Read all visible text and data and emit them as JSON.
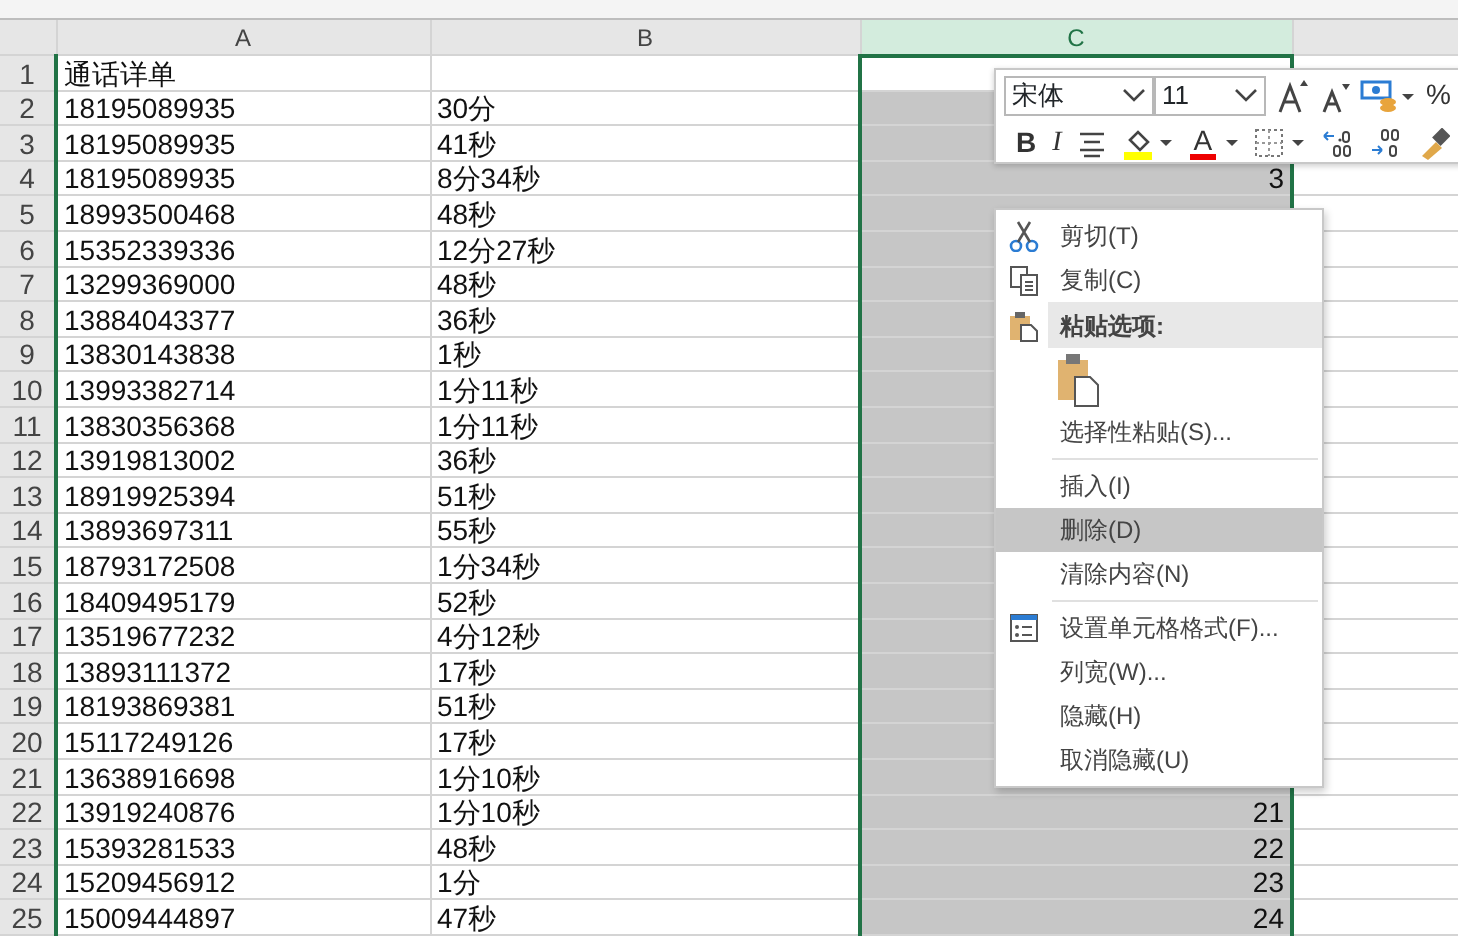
{
  "columns": [
    {
      "label": "A",
      "selected": false
    },
    {
      "label": "B",
      "selected": false
    },
    {
      "label": "C",
      "selected": true
    }
  ],
  "rows": [
    {
      "number": "1",
      "a": "通话详单",
      "b": "",
      "c": {
        "selected": false
      }
    },
    {
      "number": "2",
      "a": "18195089935",
      "b": "30分",
      "c": {
        "selected": true
      }
    },
    {
      "number": "3",
      "a": "18195089935",
      "b": "41秒",
      "c": {
        "selected": true
      }
    },
    {
      "number": "4",
      "a": "18195089935",
      "b": "8分34秒",
      "c": {
        "text": "3",
        "selected": true
      }
    },
    {
      "number": "5",
      "a": "18993500468",
      "b": "48秒",
      "c": {
        "selected": true
      }
    },
    {
      "number": "6",
      "a": "15352339336",
      "b": "12分27秒",
      "c": {
        "selected": true
      }
    },
    {
      "number": "7",
      "a": "13299369000",
      "b": "48秒",
      "c": {
        "selected": true
      }
    },
    {
      "number": "8",
      "a": "13884043377",
      "b": "36秒",
      "c": {
        "selected": true
      }
    },
    {
      "number": "9",
      "a": "13830143838",
      "b": "1秒",
      "c": {
        "selected": true
      }
    },
    {
      "number": "10",
      "a": "13993382714",
      "b": "1分11秒",
      "c": {
        "selected": true
      }
    },
    {
      "number": "11",
      "a": "13830356368",
      "b": "1分11秒",
      "c": {
        "selected": true
      }
    },
    {
      "number": "12",
      "a": "13919813002",
      "b": "36秒",
      "c": {
        "selected": true
      }
    },
    {
      "number": "13",
      "a": "18919925394",
      "b": "51秒",
      "c": {
        "selected": true
      }
    },
    {
      "number": "14",
      "a": "13893697311",
      "b": "55秒",
      "c": {
        "selected": true
      }
    },
    {
      "number": "15",
      "a": "18793172508",
      "b": "1分34秒",
      "c": {
        "selected": true
      }
    },
    {
      "number": "16",
      "a": "18409495179",
      "b": "52秒",
      "c": {
        "selected": true
      }
    },
    {
      "number": "17",
      "a": "13519677232",
      "b": "4分12秒",
      "c": {
        "selected": true
      }
    },
    {
      "number": "18",
      "a": "13893111372",
      "b": "17秒",
      "c": {
        "selected": true
      }
    },
    {
      "number": "19",
      "a": "18193869381",
      "b": "51秒",
      "c": {
        "selected": true
      }
    },
    {
      "number": "20",
      "a": "15117249126",
      "b": "17秒",
      "c": {
        "selected": true
      }
    },
    {
      "number": "21",
      "a": "13638916698",
      "b": "1分10秒",
      "c": {
        "selected": true
      }
    },
    {
      "number": "22",
      "a": "13919240876",
      "b": "1分10秒",
      "c": {
        "text": "21",
        "selected": true
      }
    },
    {
      "number": "23",
      "a": "15393281533",
      "b": "48秒",
      "c": {
        "text": "22",
        "selected": true
      }
    },
    {
      "number": "24",
      "a": "15209456912",
      "b": "1分",
      "c": {
        "text": "23",
        "selected": true
      }
    },
    {
      "number": "25",
      "a": "15009444897",
      "b": "47秒",
      "c": {
        "text": "24",
        "selected": true
      }
    }
  ],
  "mini_toolbar": {
    "font": "宋体",
    "size": "11",
    "bold": "B",
    "italic": "I",
    "font_color": "A",
    "percent": "%"
  },
  "context_menu": [
    {
      "kind": "item",
      "label": "剪切(T)",
      "selected": false
    },
    {
      "kind": "item",
      "label": "复制(C)",
      "selected": false
    },
    {
      "kind": "header",
      "label": "粘贴选项:"
    },
    {
      "kind": "paste-options"
    },
    {
      "kind": "item",
      "label": "选择性粘贴(S)...",
      "selected": false
    },
    {
      "kind": "separator"
    },
    {
      "kind": "item",
      "label": "插入(I)",
      "selected": false
    },
    {
      "kind": "item",
      "label": "删除(D)",
      "selected": true
    },
    {
      "kind": "item",
      "label": "清除内容(N)",
      "selected": false
    },
    {
      "kind": "separator"
    },
    {
      "kind": "item",
      "label": "设置单元格格式(F)...",
      "selected": false
    },
    {
      "kind": "item",
      "label": "列宽(W)...",
      "selected": false
    },
    {
      "kind": "item",
      "label": "隐藏(H)",
      "selected": false
    },
    {
      "kind": "item",
      "label": "取消隐藏(U)",
      "selected": false
    }
  ]
}
